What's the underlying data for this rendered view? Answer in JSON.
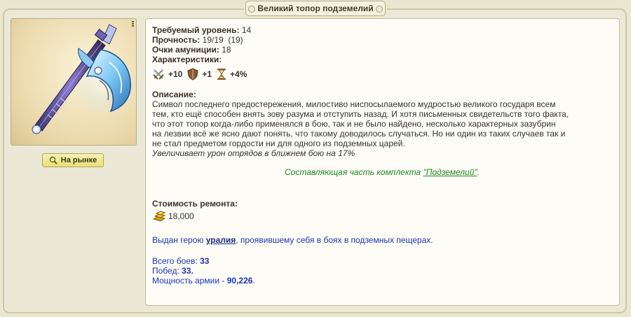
{
  "title": "Великий топор подземелий",
  "market_button": "На рынке",
  "fields": {
    "level_label": "Требуемый уровень:",
    "level_value": "14",
    "durability_label": "Прочность:",
    "durability_value": "19/19  (19)",
    "ammo_label": "Очки амуниции:",
    "ammo_value": "18",
    "chars_label": "Характеристики:"
  },
  "stats": [
    {
      "icon": "attack-swords-icon",
      "value": "+10"
    },
    {
      "icon": "defense-shield-icon",
      "value": "+1"
    },
    {
      "icon": "initiative-hourglass-icon",
      "value": "+4%"
    }
  ],
  "description": {
    "label": "Описание:",
    "lines": [
      "Символ последнего предостережения, милостиво ниспосылаемого мудростью великого государя всем",
      "тем, кто ещё способен внять зову разума и отступить назад. И хотя письменных свидетельств того факта,",
      "что этот топор когда-либо применялся в бою, так и не было найдено, несколько характерных зазубрин",
      "на лезвии всё же ясно дают понять, что такому доводилось случаться. Но ни один из таких случаев так и",
      "не стал предметом гордости ни для одного из подземных царей."
    ],
    "effect": "Увеличивает урон отрядов в ближнем бою на 17%"
  },
  "set": {
    "prefix": "Составляющая часть комплекта ",
    "link": "\"Подземелий\"",
    "suffix": "."
  },
  "repair": {
    "label": "Стоимость ремонта:",
    "gold": "18,000"
  },
  "owner": {
    "prefix": "Выдан герою ",
    "hero": "уралия",
    "suffix": ", проявившему себя в боях в подземных пещерах."
  },
  "record": {
    "battles_label": "Всего боев: ",
    "battles": "33",
    "wins_label": "Побед: ",
    "wins": "33.",
    "power_label": "Мощность армии - ",
    "power": "90,226",
    "power_end": "."
  },
  "colors": {
    "green_text": "#1c8a1c",
    "blue_text": "#1a36b5",
    "panel_bg": "#fdfcf7",
    "frame_bg": "#ece8d6"
  }
}
